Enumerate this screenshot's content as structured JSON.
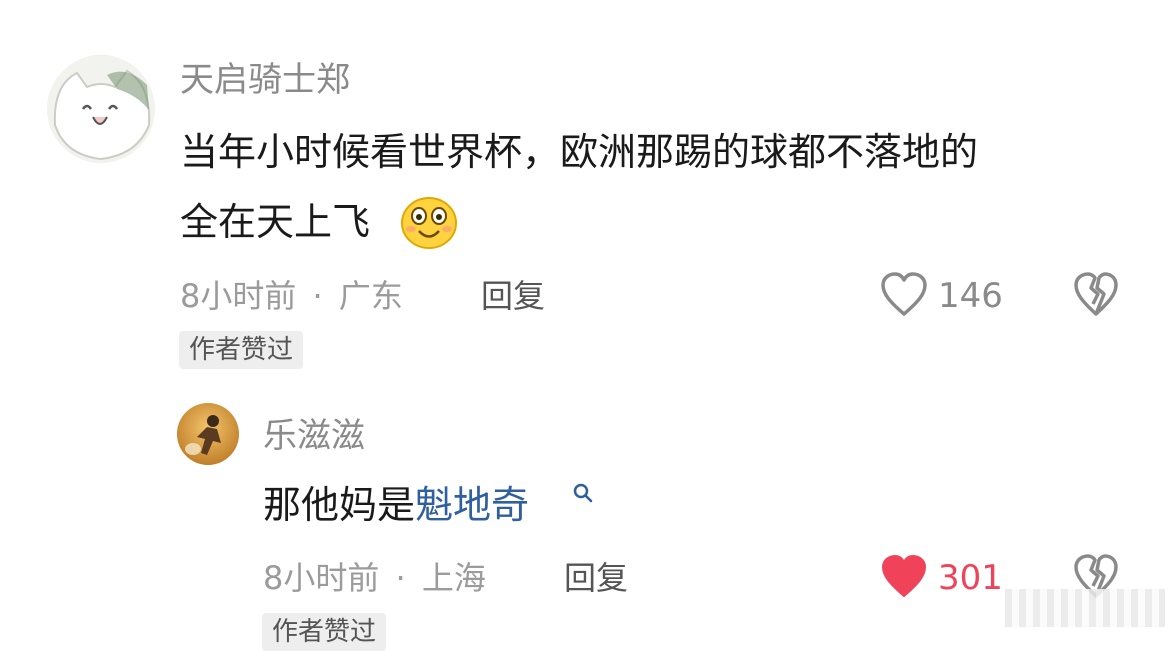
{
  "comments": [
    {
      "username": "天启骑士郑",
      "text_line1": "当年小时候看世界杯，欧洲那踢的球都不落地的",
      "text_line2": "全在天上飞",
      "emoji": "smiling-face",
      "time": "8小时前",
      "separator": "·",
      "location": "广东",
      "reply_label": "回复",
      "like_count": "146",
      "liked": false,
      "author_liked_badge": "作者赞过"
    },
    {
      "username": "乐滋滋",
      "text_prefix": "那他妈是",
      "text_link": "魁地奇",
      "time": "8小时前",
      "separator": "·",
      "location": "上海",
      "reply_label": "回复",
      "like_count": "301",
      "liked": true,
      "author_liked_badge": "作者赞过"
    }
  ],
  "colors": {
    "like_active": "#f0435a",
    "link": "#2f5f9f",
    "icon_gray": "#8a8a8a"
  }
}
